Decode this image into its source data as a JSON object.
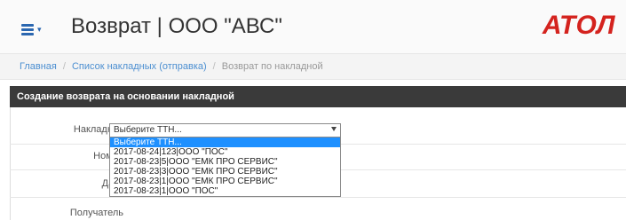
{
  "header": {
    "title": "Возврат | ООО \"АВС\"",
    "logo_text": "АТОЛ",
    "accent_color": "#2b67b0",
    "logo_color": "#d4231e",
    "menu_icon": "hamburger-menu-icon"
  },
  "breadcrumb": {
    "items": [
      "Главная",
      "Список накладных (отправка)",
      "Возврат по накладной"
    ]
  },
  "panel": {
    "heading": "Создание возврата на основании накладной"
  },
  "form": {
    "labels": {
      "invoice": "Накладная",
      "number": "Номер",
      "date": "Дата",
      "recipient": "Получатель"
    },
    "invoice_select": {
      "selected": "Выберите ТТН...",
      "options": [
        "Выберите ТТН...",
        "2017-08-24|123|ООО \"ПОС\"",
        "2017-08-23|5|ООО \"ЕМК ПРО СЕРВИС\"",
        "2017-08-23|3|ООО \"ЕМК ПРО СЕРВИС\"",
        "2017-08-23|1|ООО \"ЕМК ПРО СЕРВИС\"",
        "2017-08-23|1|ООО \"ПОС\""
      ],
      "highlight_color": "#1e90ff"
    }
  }
}
